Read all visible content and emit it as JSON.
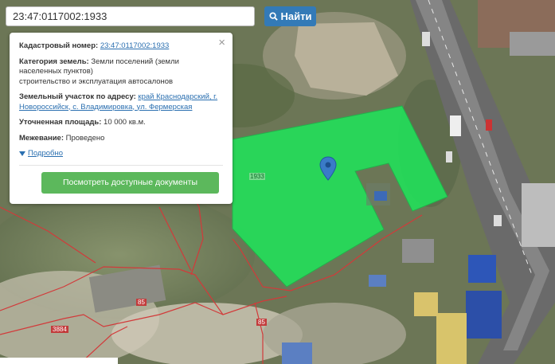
{
  "search": {
    "value": "23:47:0117002:1933",
    "button_label": "Найти"
  },
  "info_panel": {
    "cadastral_label": "Кадастровый номер:",
    "cadastral_value": "23:47:0117002:1933",
    "category_label": "Категория земель:",
    "category_value": "Земли поселений (земли населенных пунктов)",
    "category_purpose": "строительство и эксплуатация автосалонов",
    "address_label": "Земельный участок по адресу:",
    "address_value": "край Краснодарский, г. Новороссийск, с. Владимировка, ул. Фермерская",
    "area_label": "Уточненная площадь:",
    "area_value": "10 000 кв.м.",
    "survey_label": "Межевание:",
    "survey_value": "Проведено",
    "details_link": "Подробно",
    "docs_button": "Посмотреть доступные документы"
  },
  "map": {
    "parcel_label": "1933",
    "parcel_color": "#22e05a",
    "boundary_color": "#d23a3a",
    "marker_color": "#3a7bc8",
    "plot_labels": [
      "85",
      "85",
      "3884"
    ]
  }
}
